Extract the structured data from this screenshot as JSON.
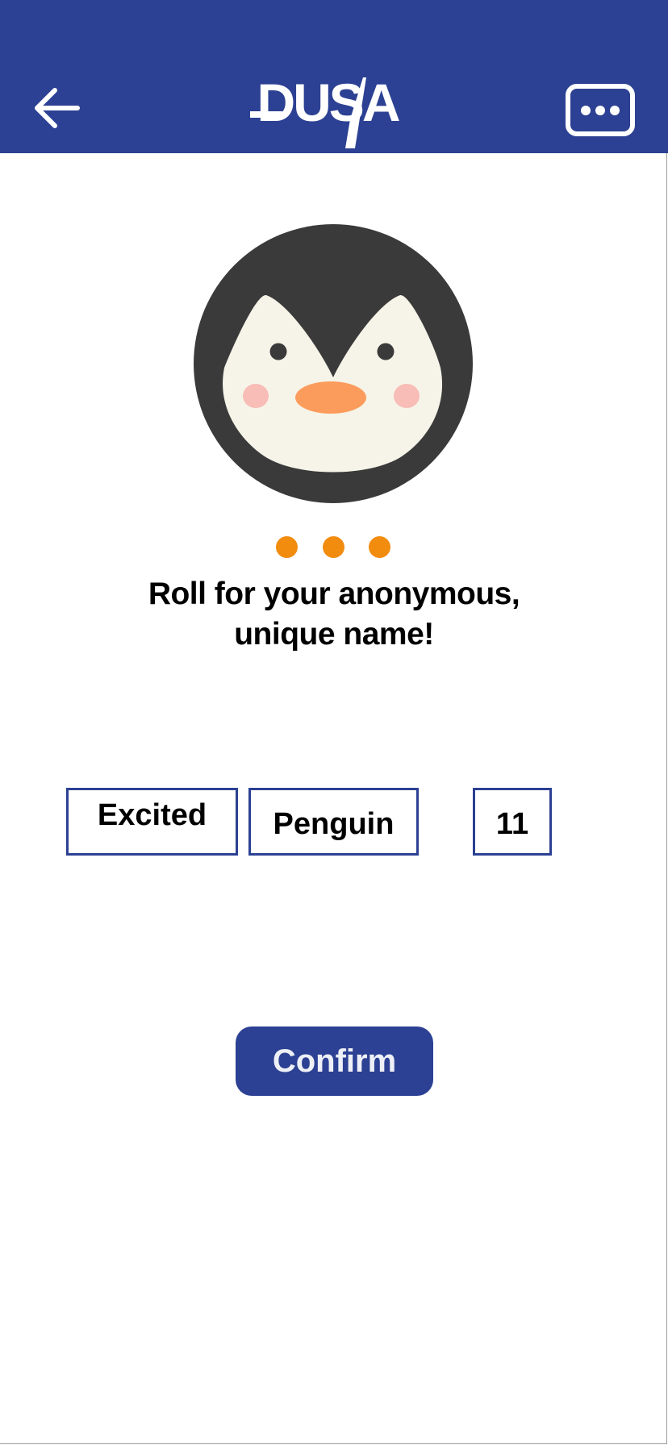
{
  "header": {
    "logo_text": "DUSA",
    "back_icon": "arrow-left-icon",
    "menu_icon": "chat-bubble-dots-icon",
    "background_color": "#2c4193"
  },
  "avatar": {
    "animal": "penguin",
    "icon": "penguin-avatar-icon"
  },
  "pager": {
    "dot_count": 3,
    "dot_color": "#f18c0f"
  },
  "prompt": {
    "line1": "Roll for your anonymous,",
    "line2": "unique name!"
  },
  "name_parts": {
    "adjective": "Excited",
    "animal": "Penguin",
    "number": "11"
  },
  "confirm": {
    "label": "Confirm",
    "color": "#2c4193"
  }
}
